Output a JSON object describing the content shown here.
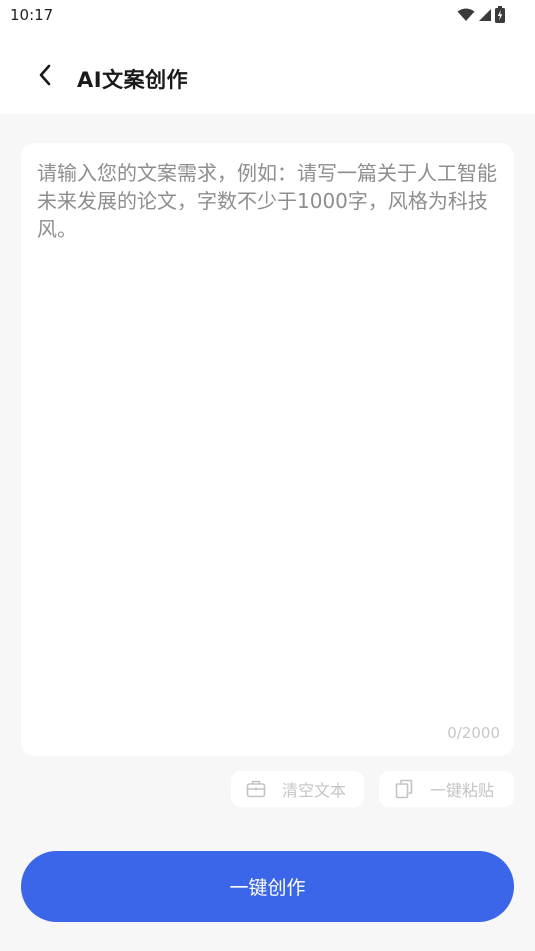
{
  "status_bar": {
    "time": "10:17",
    "icons": [
      "wifi-icon",
      "cellular-signal-icon",
      "battery-charging-icon"
    ]
  },
  "header": {
    "back_icon": "chevron-left-icon",
    "title": "AI文案创作"
  },
  "editor": {
    "value": "",
    "placeholder": "请输入您的文案需求，例如：请写一篇关于人工智能未来发展的论文，字数不少于1000字，风格为科技风。",
    "counter": "0/2000"
  },
  "actions": {
    "clear_label": "清空文本",
    "clear_icon": "clear-text-icon",
    "paste_label": "一键粘贴",
    "paste_icon": "copy-paste-icon"
  },
  "primary_button": {
    "label": "一键创作"
  },
  "colors": {
    "accent": "#3b66e9",
    "page_background": "#f7f7f8",
    "card_background": "#ffffff",
    "placeholder_text": "#8e8e8e",
    "muted_text": "#c4c4c4"
  }
}
